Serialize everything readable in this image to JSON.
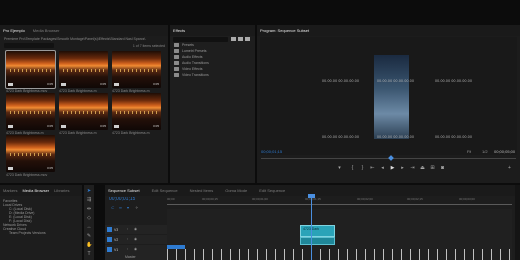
{
  "project": {
    "tabs": [
      "Pro Ejemplo",
      "Media Browser",
      "Libraries"
    ],
    "path": "Premiere Pro\\Template Packages\\Smooth Montage\\Panel(s)\\Effects\\Standard Nasl Sparcs\\",
    "item_count": "1 of 7 items selected",
    "clips": [
      {
        "label": "4723 Dark Brightness.mov",
        "duration": "0:05"
      },
      {
        "label": "4723 Dark Brightness.m",
        "duration": "0:05"
      },
      {
        "label": "4723 Dark Brightness.m",
        "duration": "0:05"
      },
      {
        "label": "4723 Dark Brightness.m",
        "duration": "0:05"
      },
      {
        "label": "4723 Dark Brightness.m",
        "duration": "0:05"
      },
      {
        "label": "4723 Dark Brightness.m",
        "duration": "0:05"
      },
      {
        "label": "4723 Dark Brightness.mov",
        "duration": "0:05"
      }
    ]
  },
  "effects": {
    "tab": "Effects",
    "folders": [
      "Presets",
      "Lumetri Presets",
      "Audio Effects",
      "Audio Transitions",
      "Video Effects",
      "Video Transitions"
    ]
  },
  "program": {
    "tab": "Program: Sequence Subset",
    "overlay_lines": [
      "00.00.00 00.00.00.00",
      "00.00.00 00.00.00.00"
    ],
    "timecode": "00;00;01;15",
    "fit": "Fit",
    "zoom": "1/2",
    "end_timecode": "00;00;05;00"
  },
  "browser": {
    "tabs": [
      "Markers",
      "Media Browser",
      "Libraries"
    ],
    "tree": [
      "Favorites",
      "Local Drives",
      "C: (Local Disk)",
      "D: (Media Drive)",
      "E: (Local Disk)",
      "F: (Local Disk)",
      "Network Drives",
      "Creative Cloud",
      "Team Projects Versions"
    ]
  },
  "timeline": {
    "tabs": [
      "Sequence Subset",
      "Edit Sequence",
      "Nested Items",
      "Ooma Mode",
      "Edit Sequence"
    ],
    "timecode": "00;00;01;15",
    "ruler": [
      "00;00",
      "00;00;00;15",
      "00;00;01;00",
      "00;00;01;15",
      "00;00;02;00",
      "00;00;02;15",
      "00;00;03;00"
    ],
    "video_tracks": [
      "V3",
      "V2",
      "V1"
    ],
    "audio_tracks": [
      "A1"
    ],
    "clip_label": "4723 Dark",
    "audio_label": "Master"
  },
  "colors": {
    "accent": "#2e7bd1",
    "clip_teal": "#2aa3b8",
    "playhead": "#4a8fe0"
  }
}
